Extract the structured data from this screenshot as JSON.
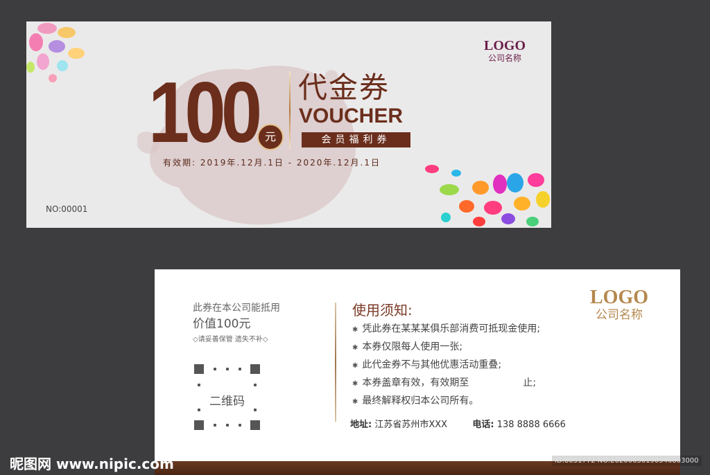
{
  "front": {
    "amount": "100",
    "unit": "元",
    "title_cn": "代金券",
    "title_en": "VOUCHER",
    "tag": "会员福利券",
    "validity": "有效期: 2019年.12月.1日 - 2020年.12月.1日",
    "logo": "LOGO",
    "company": "公司名称",
    "number": "NO:00001"
  },
  "back": {
    "line1": "此券在本公司能抵用",
    "line2": "价值100元",
    "line3": "◇请妥善保管 遗失不补◇",
    "qr_label": "二维码",
    "notes_title": "使用须知:",
    "notes": [
      "凭此券在某某某俱乐部消费可抵现金使用;",
      "本券仅限每人使用一张;",
      "此代金券不与其他优惠活动重叠;",
      "本券盖章有效，有效期至",
      "最终解释权归本公司所有。"
    ],
    "note4_tail": "止;",
    "address_label": "地址:",
    "address": "江苏省苏州市XXX",
    "phone_label": "电话:",
    "phone": "138 8888 6666",
    "logo": "LOGO",
    "company": "公司名称"
  },
  "colors": {
    "brand": "#6b2e1c",
    "gold": "#b5874d",
    "background": "#3d3d3f"
  },
  "watermark": {
    "site": "昵图网 www.nipic.com",
    "id": "ID:8051772 NO:20200630190546803000"
  }
}
